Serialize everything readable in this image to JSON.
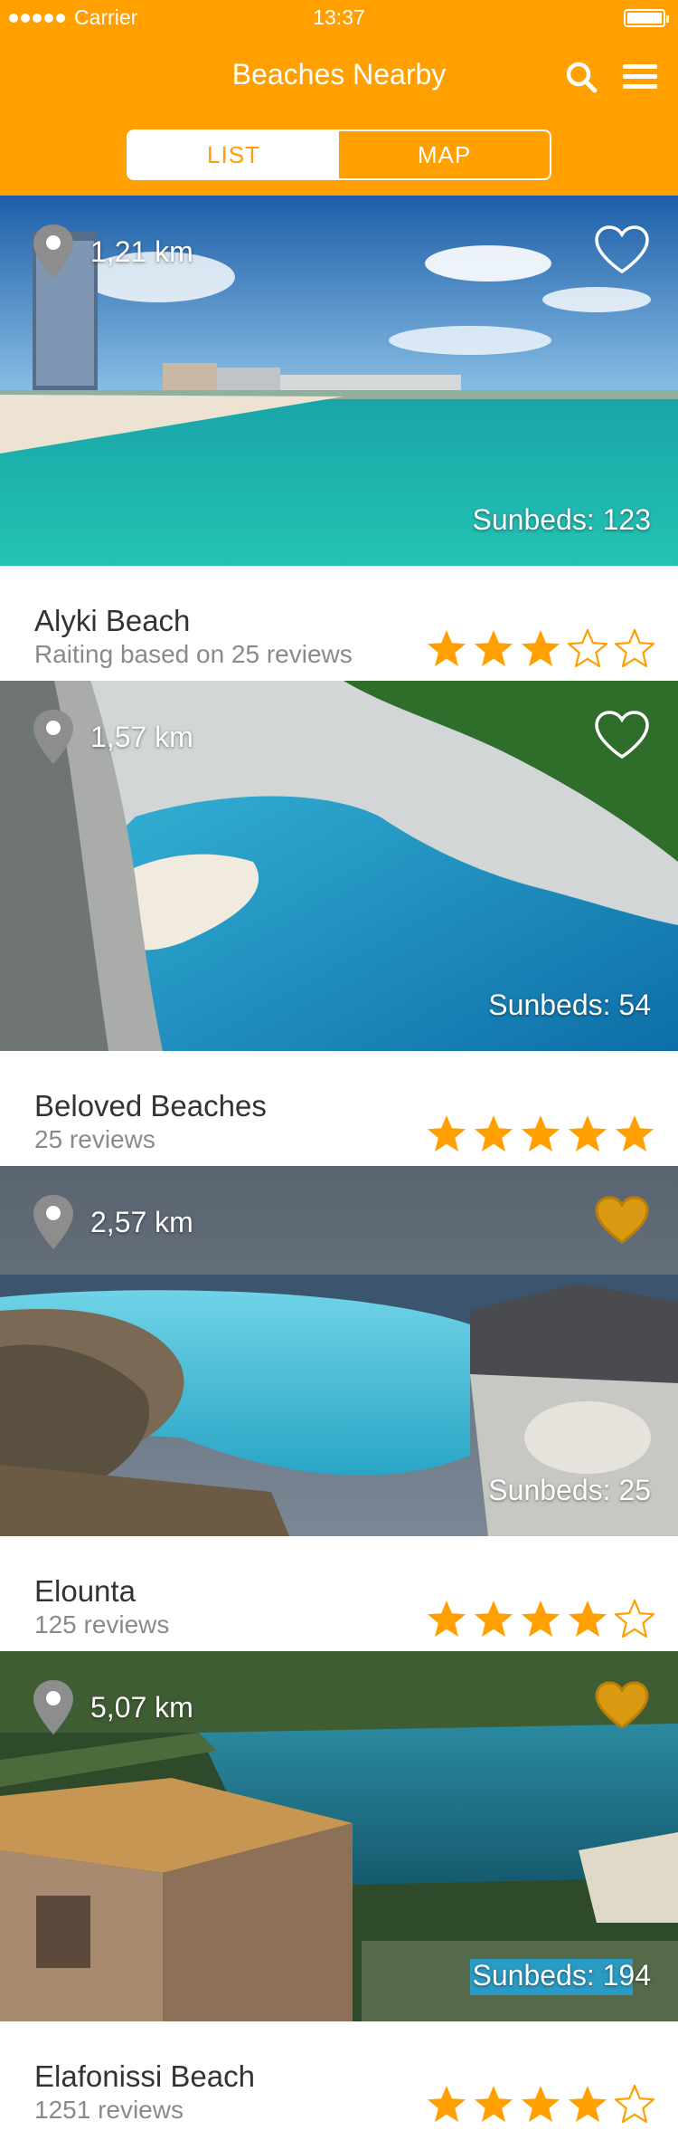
{
  "statusbar": {
    "carrier": "Carrier",
    "time": "13:37"
  },
  "header": {
    "title": "Beaches Nearby",
    "search_icon": "search-icon",
    "menu_icon": "hamburger-menu-icon",
    "tabs": [
      {
        "label": "LIST",
        "active": true
      },
      {
        "label": "MAP",
        "active": false
      }
    ]
  },
  "colors": {
    "accent": "#ff9f00",
    "text_primary": "#333333",
    "text_secondary": "#8a8a8a"
  },
  "beaches": [
    {
      "distance": "1,21 km",
      "sunbeds": "Sunbeds: 123",
      "name": "Alyki Beach",
      "reviews": "Raiting based on 25 reviews",
      "rating": 3,
      "favorite": false
    },
    {
      "distance": "1,57 km",
      "sunbeds": "Sunbeds: 54",
      "name": "Beloved Beaches",
      "reviews": "25 reviews",
      "rating": 5,
      "favorite": false
    },
    {
      "distance": "2,57 km",
      "sunbeds": "Sunbeds: 25",
      "name": "Elounta",
      "reviews": "125 reviews",
      "rating": 4,
      "favorite": true
    },
    {
      "distance": "5,07 km",
      "sunbeds": "Sunbeds: 194",
      "name": "Elafonissi Beach",
      "reviews": "1251 reviews",
      "rating": 4,
      "favorite": true
    }
  ]
}
